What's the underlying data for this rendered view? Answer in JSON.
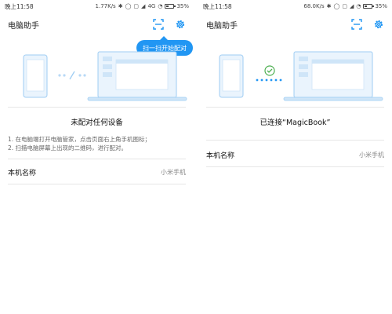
{
  "left": {
    "statusbar": {
      "time": "晚上11:58",
      "speed": "1.77K/s",
      "network": "4G",
      "battery": "35%"
    },
    "appbar": {
      "title": "电脑助手"
    },
    "tooltip": "扫一扫开始配对",
    "status_title": "未配对任何设备",
    "instructions": [
      "1. 在电脑端打开电脑管家，点击页面右上角手机图标；",
      "2. 扫描电脑屏幕上出现的二维码，进行配对。"
    ],
    "device_name": {
      "label": "本机名称",
      "value": "小米手机"
    }
  },
  "right": {
    "statusbar": {
      "time": "晚上11:58",
      "speed": "68.0K/s",
      "battery": "35%"
    },
    "appbar": {
      "title": "电脑助手"
    },
    "status_title": "已连接“MagicBook”",
    "device_name": {
      "label": "本机名称",
      "value": "小米手机"
    }
  },
  "colors": {
    "accent": "#2196f3",
    "connected": "#4caf50",
    "illustration_line": "#9fcdf3",
    "illustration_fill": "#eaf4fd"
  },
  "icons": {
    "scan": "scan-icon",
    "settings": "gear-icon",
    "check": "check-circle-icon"
  }
}
